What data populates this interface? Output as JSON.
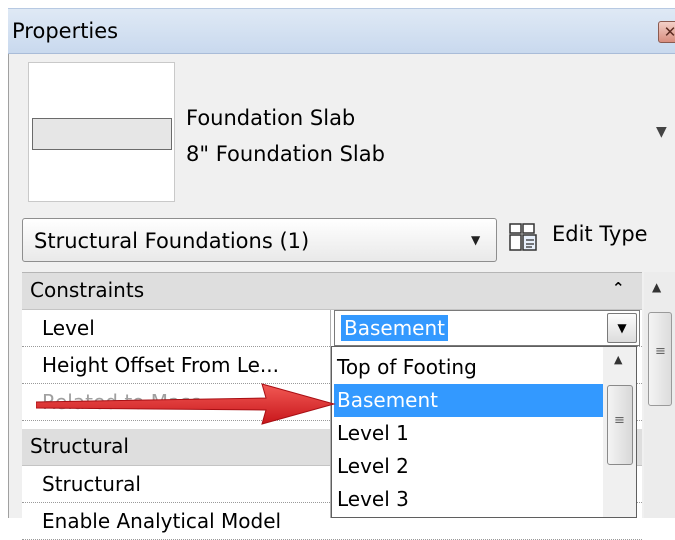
{
  "window": {
    "title": "Properties",
    "close_glyph": "✕"
  },
  "type_selector": {
    "family": "Foundation Slab",
    "type": "8\" Foundation Slab",
    "dropdown_glyph": "▼"
  },
  "filter": {
    "category": "Structural Foundations (1)",
    "arrow_glyph": "▼",
    "edit_type_label": "Edit Type"
  },
  "grid": {
    "groups": [
      {
        "label": "Constraints",
        "collapse_glyph": "⌃"
      },
      {
        "label": "Structural"
      }
    ],
    "properties": [
      {
        "name": "Level",
        "disabled": false
      },
      {
        "name": "Height Offset From Le...",
        "disabled": false
      },
      {
        "name": "Related to Mass",
        "disabled": true
      },
      {
        "name": "Structural",
        "disabled": false
      },
      {
        "name": "Enable Analytical Model",
        "disabled": false
      }
    ],
    "scroll_up_glyph": "▲"
  },
  "level_combo": {
    "value": "Basement",
    "button_glyph": "▼",
    "options": [
      "Top of Footing",
      "Basement",
      "Level 1",
      "Level 2",
      "Level 3"
    ],
    "selected_index": 1,
    "scroll_up_glyph": "▲"
  },
  "colors": {
    "selection": "#3399ff",
    "annotation_arrow": "#e0282a",
    "title_bar": "#d3e1f2"
  },
  "icons": {
    "close": "close-icon",
    "edit_type": "edit-type-icon",
    "annotation": "red-arrow-icon"
  }
}
